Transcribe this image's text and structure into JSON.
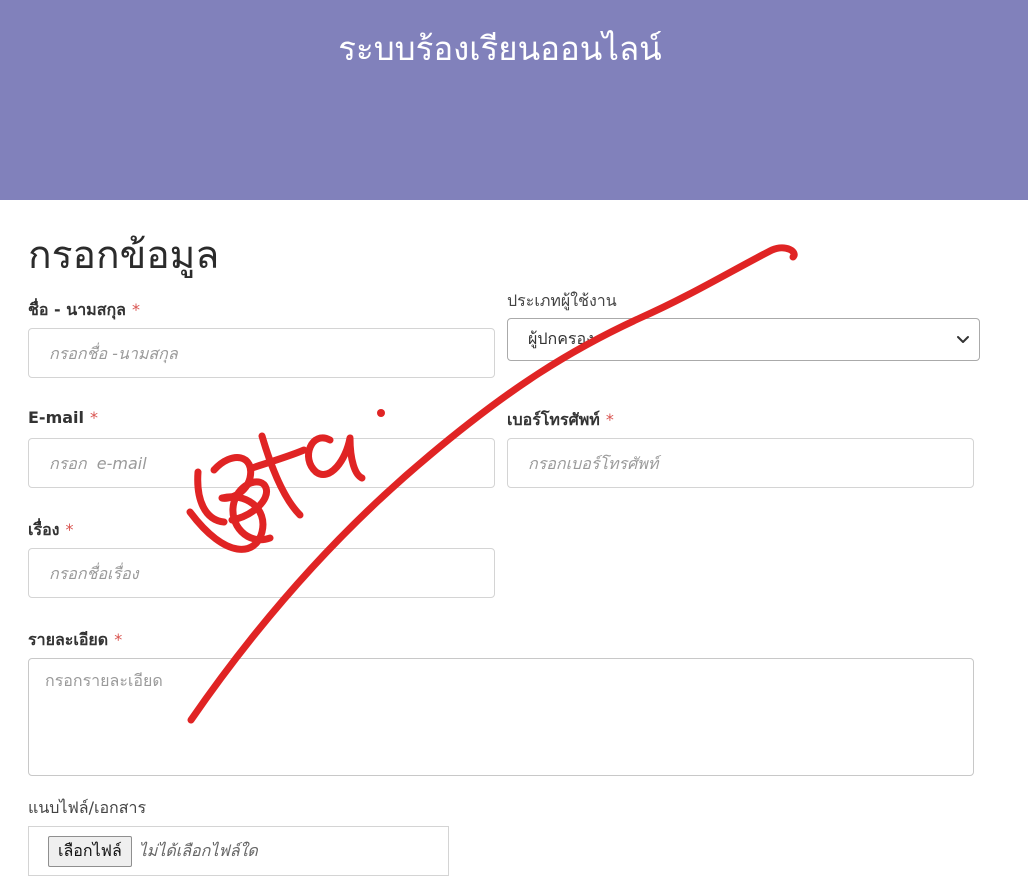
{
  "header": {
    "title": "ระบบร้องเรียนออนไลน์"
  },
  "form": {
    "title": "กรอกข้อมูล",
    "required_mark": "*",
    "fullname": {
      "label": "ชื่อ - นามสกุล",
      "placeholder": "กรอกชื่อ -นามสกุล"
    },
    "user_type": {
      "label": "ประเภทผู้ใช้งาน",
      "selected": "ผู้ปกครอง"
    },
    "email": {
      "label": "E-mail",
      "placeholder": "กรอก  e-mail"
    },
    "phone": {
      "label": "เบอร์โทรศัพท์",
      "placeholder": "กรอกเบอร์โทรศัพท์"
    },
    "subject": {
      "label": "เรื่อง",
      "placeholder": "กรอกชื่อเรื่อง"
    },
    "details": {
      "label": "รายละเอียด",
      "placeholder": "กรอกรายละเอียด"
    },
    "attachment": {
      "label": "แนบไฟล์/เอกสาร",
      "button_label": "เลือกไฟล์",
      "status": "ไม่ได้เลือกไฟล์ใด"
    }
  },
  "overlay": {
    "handwritten_text": "Beta",
    "color": "#e02424"
  }
}
